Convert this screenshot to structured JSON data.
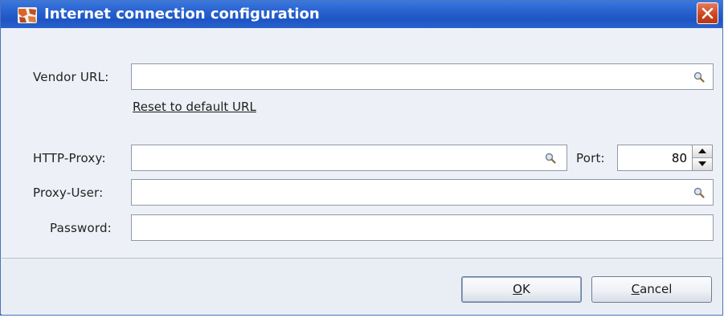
{
  "window": {
    "title": "Internet connection configuration",
    "title_bar_color": "#2a64d0",
    "app_icon": "app-logo-icon",
    "close_icon": "close-icon"
  },
  "form": {
    "vendor_url": {
      "label": "Vendor URL:",
      "value": "",
      "icon": "search-icon"
    },
    "reset_link": "Reset to default URL",
    "http_proxy": {
      "label": "HTTP-Proxy:",
      "value": "",
      "icon": "search-icon"
    },
    "port": {
      "label": "Port:",
      "value": "80"
    },
    "proxy_user": {
      "label": "Proxy-User:",
      "value": "",
      "icon": "search-icon"
    },
    "password": {
      "label": "Password:",
      "value": ""
    }
  },
  "buttons": {
    "ok": {
      "mnemonic": "O",
      "rest": "K"
    },
    "cancel": {
      "mnemonic": "C",
      "rest": "ancel"
    }
  }
}
